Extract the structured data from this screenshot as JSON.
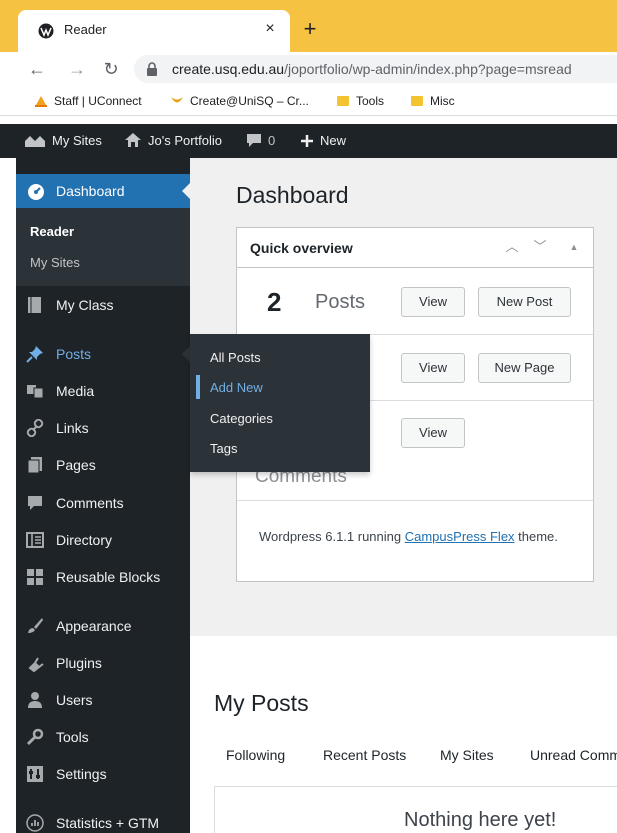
{
  "browser": {
    "tab_title": "Reader",
    "tab_close": "×",
    "new_tab": "+",
    "url_host": "create.usq.edu.au",
    "url_path": "/joportfolio/wp-admin/index.php?page=msread",
    "bookmarks": [
      {
        "label": "Staff | UConnect",
        "icon": "sun-icon",
        "color": "#f2a31b"
      },
      {
        "label": "Create@UniSQ – Cr...",
        "icon": "wing-icon",
        "color": "#e8a317"
      },
      {
        "label": "Tools",
        "icon": "folder-icon",
        "color": "#f4c430"
      },
      {
        "label": "Misc",
        "icon": "folder-icon",
        "color": "#f4c430"
      }
    ],
    "tabstrip_color": "#f5c242"
  },
  "adminbar": {
    "my_sites": "My Sites",
    "site_name": "Jo's Portfolio",
    "comments_count": "0",
    "new_label": "New"
  },
  "sidebar": {
    "dashboard": "Dashboard",
    "dashboard_sub": [
      "Reader",
      "My Sites"
    ],
    "items": [
      {
        "name": "my-class",
        "label": "My Class",
        "icon": "book-icon"
      },
      {
        "name": "posts",
        "label": "Posts",
        "icon": "pin-icon"
      },
      {
        "name": "media",
        "label": "Media",
        "icon": "media-icon"
      },
      {
        "name": "links",
        "label": "Links",
        "icon": "link-icon"
      },
      {
        "name": "pages",
        "label": "Pages",
        "icon": "pages-icon"
      },
      {
        "name": "comments",
        "label": "Comments",
        "icon": "comment-icon"
      },
      {
        "name": "directory",
        "label": "Directory",
        "icon": "directory-icon"
      },
      {
        "name": "reusable-blocks",
        "label": "Reusable Blocks",
        "icon": "blocks-icon"
      },
      {
        "name": "appearance",
        "label": "Appearance",
        "icon": "brush-icon"
      },
      {
        "name": "plugins",
        "label": "Plugins",
        "icon": "plugin-icon"
      },
      {
        "name": "users",
        "label": "Users",
        "icon": "user-icon"
      },
      {
        "name": "tools",
        "label": "Tools",
        "icon": "wrench-icon"
      },
      {
        "name": "settings",
        "label": "Settings",
        "icon": "settings-icon"
      },
      {
        "name": "statistics",
        "label": "Statistics + GTM",
        "icon": "stats-icon"
      }
    ],
    "accent": "#2271b1"
  },
  "posts_flyout": {
    "items": [
      "All Posts",
      "Add New",
      "Categories",
      "Tags"
    ],
    "active": "Add New"
  },
  "main": {
    "title": "Dashboard",
    "quick_overview": {
      "title": "Quick overview",
      "rows": [
        {
          "count": "2",
          "label": "Posts",
          "view": "View",
          "action": "New Post"
        },
        {
          "count": "",
          "label": "",
          "view": "View",
          "action": "New Page"
        },
        {
          "count": "",
          "label": "Comments",
          "view": "View",
          "action": ""
        }
      ],
      "footer_prefix": "Wordpress 6.1.1 running ",
      "footer_link": "CampusPress Flex",
      "footer_suffix": " theme."
    },
    "my_posts": {
      "title": "My Posts",
      "tabs": [
        "Following",
        "Recent Posts",
        "My Sites",
        "Unread Comm"
      ],
      "empty_text": "Nothing here yet!"
    }
  }
}
